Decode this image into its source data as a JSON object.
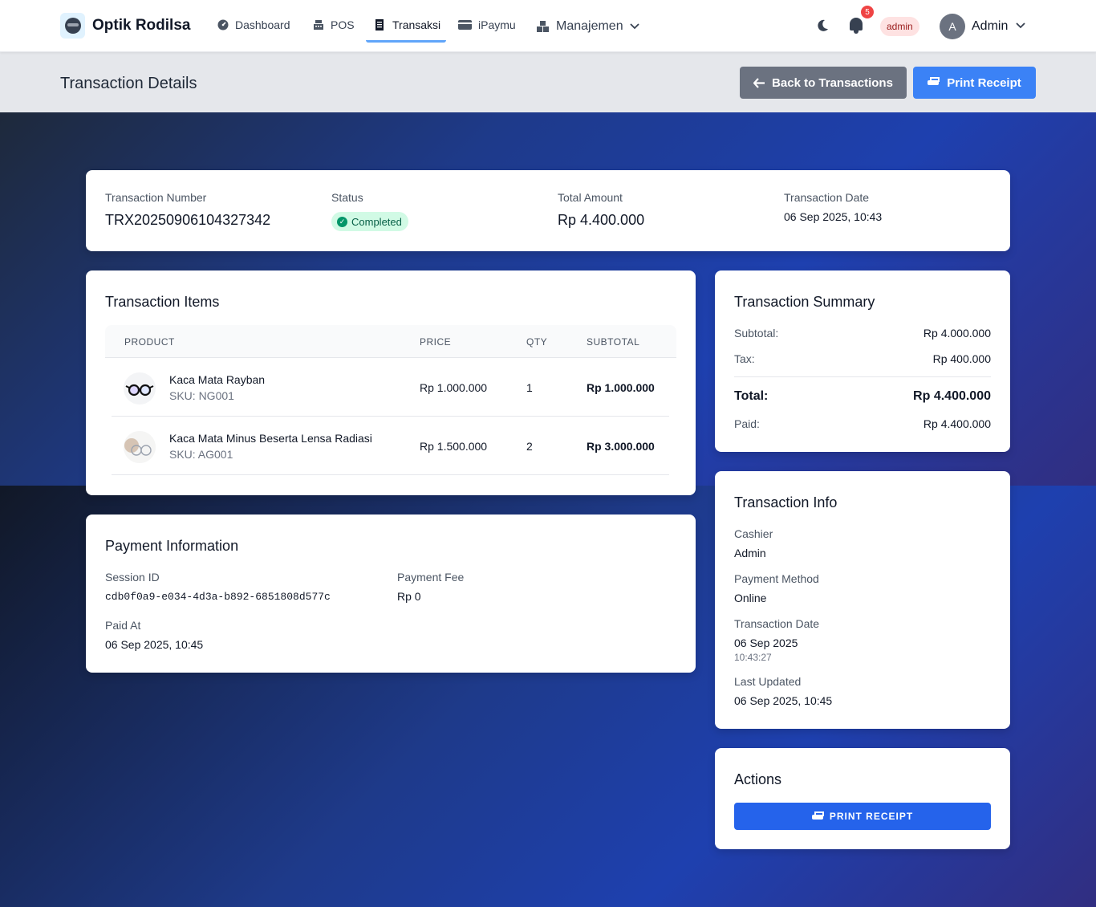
{
  "app": {
    "brand": "Optik Rodilsa"
  },
  "nav": {
    "items": [
      {
        "label": "Dashboard",
        "icon": "dashboard-icon"
      },
      {
        "label": "POS",
        "icon": "cash-register-icon"
      },
      {
        "label": "Transaksi",
        "icon": "receipt-icon",
        "active": true
      },
      {
        "label": "iPaymu",
        "icon": "credit-card-icon"
      },
      {
        "label": "Manajemen",
        "icon": "boxes-icon",
        "dropdown": true
      }
    ],
    "notification_count": "5",
    "role_badge": "admin",
    "avatar_initial": "A",
    "user_name": "Admin"
  },
  "header": {
    "title": "Transaction Details",
    "back_label": "Back to Transactions",
    "print_label": "Print Receipt"
  },
  "overview": {
    "number_label": "Transaction Number",
    "number": "TRX20250906104327342",
    "status_label": "Status",
    "status": "Completed",
    "total_label": "Total Amount",
    "total": "Rp 4.400.000",
    "date_label": "Transaction Date",
    "date": "06 Sep 2025, 10:43"
  },
  "items": {
    "title": "Transaction Items",
    "columns": [
      "PRODUCT",
      "PRICE",
      "QTY",
      "SUBTOTAL"
    ],
    "rows": [
      {
        "name": "Kaca Mata Rayban",
        "sku": "SKU: NG001",
        "price": "Rp 1.000.000",
        "qty": "1",
        "subtotal": "Rp 1.000.000"
      },
      {
        "name": "Kaca Mata Minus Beserta Lensa Radiasi",
        "sku": "SKU: AG001",
        "price": "Rp 1.500.000",
        "qty": "2",
        "subtotal": "Rp 3.000.000"
      }
    ]
  },
  "payment": {
    "title": "Payment Information",
    "session_label": "Session ID",
    "session_id": "cdb0f0a9-e034-4d3a-b892-6851808d577c",
    "fee_label": "Payment Fee",
    "fee": "Rp 0",
    "paid_at_label": "Paid At",
    "paid_at": "06 Sep 2025, 10:45"
  },
  "summary": {
    "title": "Transaction Summary",
    "subtotal_label": "Subtotal:",
    "subtotal": "Rp 4.000.000",
    "tax_label": "Tax:",
    "tax": "Rp 400.000",
    "total_label": "Total:",
    "total": "Rp 4.400.000",
    "paid_label": "Paid:",
    "paid": "Rp 4.400.000"
  },
  "info": {
    "title": "Transaction Info",
    "cashier_label": "Cashier",
    "cashier": "Admin",
    "method_label": "Payment Method",
    "method": "Online",
    "date_label": "Transaction Date",
    "date": "06 Sep 2025",
    "time": "10:43:27",
    "updated_label": "Last Updated",
    "updated": "06 Sep 2025, 10:45"
  },
  "actions": {
    "title": "Actions",
    "print_label": "PRINT RECEIPT"
  },
  "colors": {
    "primary": "#3b82f6",
    "secondary": "#6b7280",
    "success_bg": "#d1fae5",
    "success_text": "#065f46",
    "danger": "#ef4444"
  }
}
